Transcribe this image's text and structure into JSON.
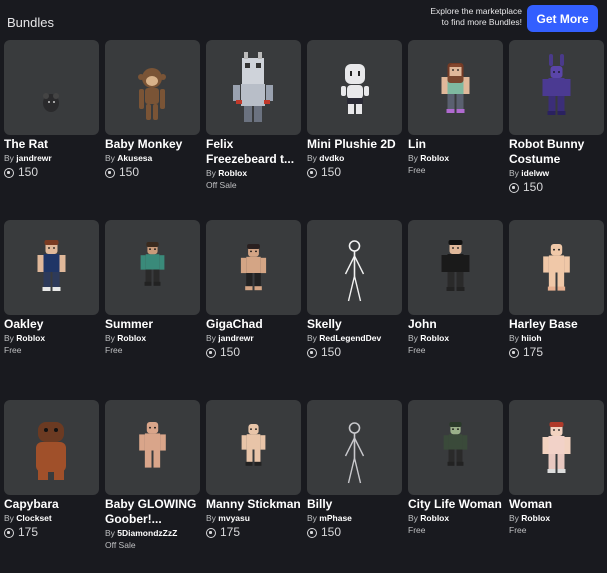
{
  "header": {
    "title": "Bundles",
    "promo_line1": "Explore the marketplace",
    "promo_line2": "to find more Bundles!",
    "get_more_label": "Get More"
  },
  "items": [
    {
      "name": "The Rat",
      "by": "By",
      "creator": "jandrewr",
      "price": "150",
      "status": "",
      "avatar": "rat"
    },
    {
      "name": "Baby Monkey",
      "by": "By",
      "creator": "Akusesa",
      "price": "150",
      "status": "",
      "avatar": "monkey"
    },
    {
      "name": "Felix Freezebeard t...",
      "by": "By",
      "creator": "Roblox",
      "price": "",
      "status": "Off Sale",
      "avatar": "felix"
    },
    {
      "name": "Mini Plushie 2D",
      "by": "By",
      "creator": "dvdko",
      "price": "150",
      "status": "",
      "avatar": "plushie"
    },
    {
      "name": "Lin",
      "by": "By",
      "creator": "Roblox",
      "price": "",
      "status": "Free",
      "avatar": "lin"
    },
    {
      "name": "Robot Bunny Costume",
      "by": "By",
      "creator": "idelww",
      "price": "150",
      "status": "",
      "avatar": "bunny"
    },
    {
      "name": "Oakley",
      "by": "By",
      "creator": "Roblox",
      "price": "",
      "status": "Free",
      "avatar": "oakley"
    },
    {
      "name": "Summer",
      "by": "By",
      "creator": "Roblox",
      "price": "",
      "status": "Free",
      "avatar": "summer"
    },
    {
      "name": "GigaChad",
      "by": "By",
      "creator": "jandrewr",
      "price": "150",
      "status": "",
      "avatar": "gigachad"
    },
    {
      "name": "Skelly",
      "by": "By",
      "creator": "RedLegendDev",
      "price": "150",
      "status": "",
      "avatar": "skelly"
    },
    {
      "name": "John",
      "by": "By",
      "creator": "Roblox",
      "price": "",
      "status": "Free",
      "avatar": "john"
    },
    {
      "name": "Harley Base",
      "by": "By",
      "creator": "hiioh",
      "price": "175",
      "status": "",
      "avatar": "harley"
    },
    {
      "name": "Capybara",
      "by": "By",
      "creator": "Clockset",
      "price": "175",
      "status": "",
      "avatar": "capybara"
    },
    {
      "name": "Baby GLOWING Goober!...",
      "by": "By",
      "creator": "5DiamondzZzZ",
      "price": "",
      "status": "Off Sale",
      "avatar": "goober"
    },
    {
      "name": "Manny Stickman",
      "by": "By",
      "creator": "mvyasu",
      "price": "175",
      "status": "",
      "avatar": "manny"
    },
    {
      "name": "Billy",
      "by": "By",
      "creator": "mPhase",
      "price": "150",
      "status": "",
      "avatar": "billy"
    },
    {
      "name": "City Life Woman",
      "by": "By",
      "creator": "Roblox",
      "price": "",
      "status": "Free",
      "avatar": "citylife"
    },
    {
      "name": "Woman",
      "by": "By",
      "creator": "Roblox",
      "price": "",
      "status": "Free",
      "avatar": "woman"
    }
  ],
  "colors": {
    "background": "#191a1f",
    "card": "#393b3d",
    "accent": "#335fff"
  }
}
